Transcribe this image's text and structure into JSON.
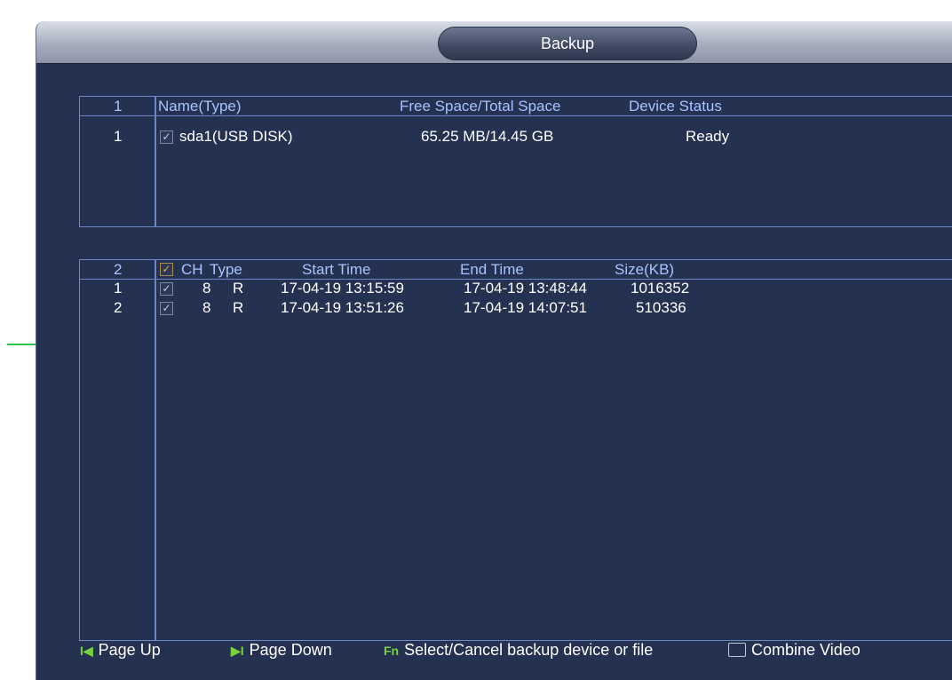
{
  "window": {
    "title": "Backup"
  },
  "devices": {
    "index_header": "1",
    "columns": [
      "Name(Type)",
      "Free Space/Total Space",
      "Device Status"
    ],
    "rows": [
      {
        "index": "1",
        "name": "sda1(USB DISK)",
        "space": "65.25 MB/14.45 GB",
        "status": "Ready",
        "checked": true
      }
    ]
  },
  "files": {
    "index_header": "2",
    "columns": [
      "CH",
      "Type",
      "Start Time",
      "End Time",
      "Size(KB)"
    ],
    "rows": [
      {
        "index": "1",
        "ch": "8",
        "type": "R",
        "start": "17-04-19 13:15:59",
        "end": "17-04-19 13:48:44",
        "size": "1016352",
        "checked": true
      },
      {
        "index": "2",
        "ch": "8",
        "type": "R",
        "start": "17-04-19 13:51:26",
        "end": "17-04-19 14:07:51",
        "size": "510336",
        "checked": true
      }
    ]
  },
  "footer": {
    "page_up": "Page Up",
    "page_down": "Page Down",
    "select_hint": "Select/Cancel backup device or file",
    "combine_video": "Combine Video"
  },
  "icons": {
    "checkmark": "✓",
    "page_up": "I◀",
    "page_down": "▶I",
    "select": "Fn"
  },
  "colors": {
    "window_bg": "#243150",
    "table_border": "#6f86c6",
    "header_text": "#a8c3ff",
    "footer_icon": "#7ad23a"
  }
}
